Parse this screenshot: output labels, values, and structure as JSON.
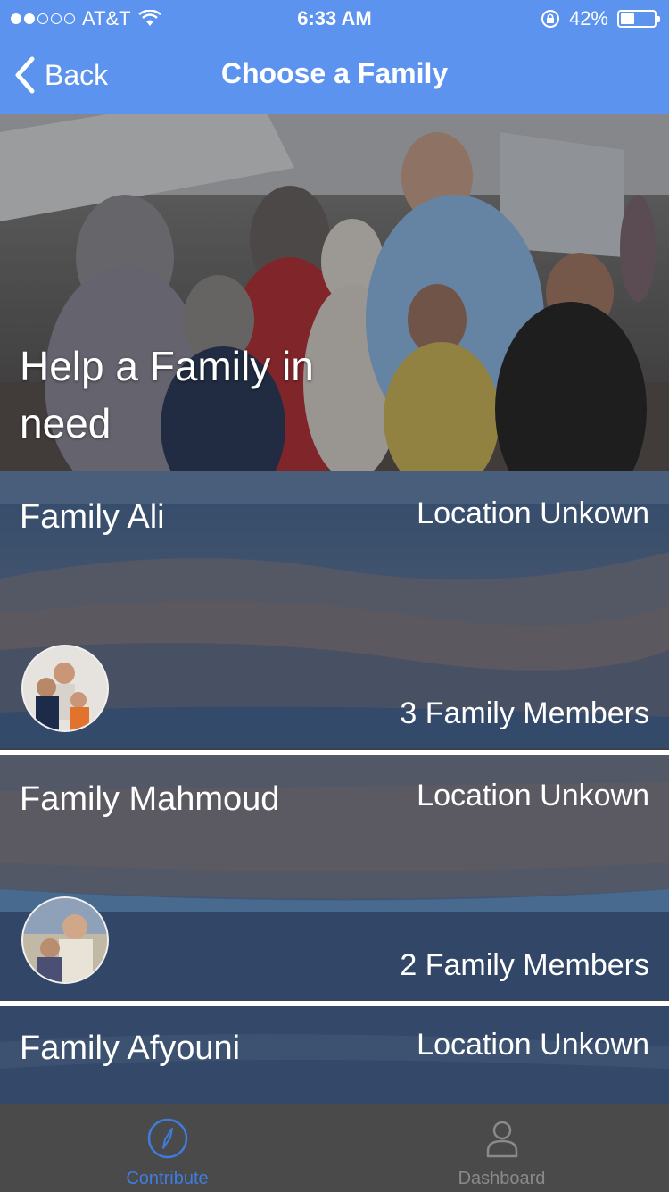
{
  "status_bar": {
    "carrier": "AT&T",
    "time": "6:33 AM",
    "battery": "42%",
    "battery_level": 0.42,
    "signal_bars": 2
  },
  "nav": {
    "back_label": "Back",
    "title": "Choose a Family"
  },
  "hero": {
    "title": "Help a Family in need"
  },
  "families": [
    {
      "name": "Family Ali",
      "location": "Location Unkown",
      "members": "3 Family Members"
    },
    {
      "name": "Family Mahmoud",
      "location": "Location Unkown",
      "members": "2 Family Members"
    },
    {
      "name": "Family Afyouni",
      "location": "Location Unkown",
      "members": ""
    }
  ],
  "tabs": [
    {
      "label": "Contribute",
      "icon": "compass-icon",
      "active": true
    },
    {
      "label": "Dashboard",
      "icon": "person-icon",
      "active": false
    }
  ],
  "colors": {
    "nav_background": "#5c93ef",
    "tab_active": "#3d7de0",
    "tab_inactive": "#8a8a8a",
    "tabbar_background": "#4a4a4a"
  }
}
